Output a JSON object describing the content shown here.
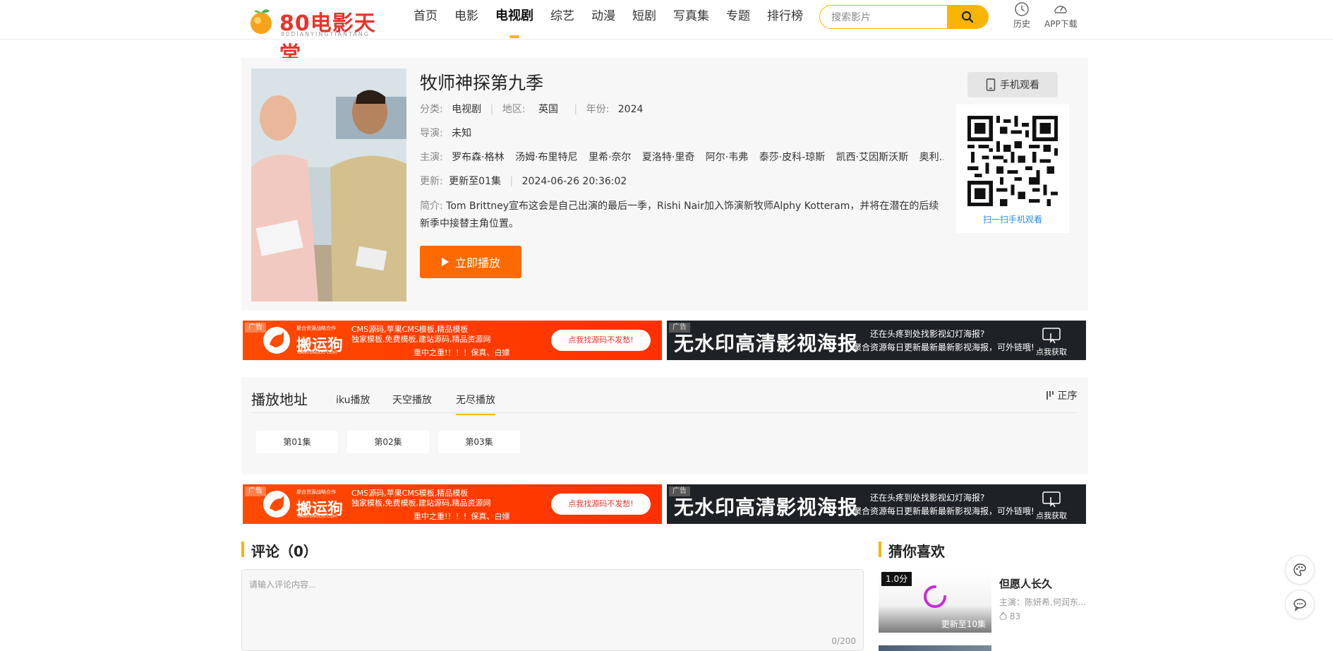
{
  "site": {
    "logo_text": "80电影天堂",
    "logo_sub": "80DIANYINGTIANTANG"
  },
  "nav": {
    "items": [
      {
        "label": "首页"
      },
      {
        "label": "电影"
      },
      {
        "label": "电视剧",
        "active": true
      },
      {
        "label": "综艺"
      },
      {
        "label": "动漫"
      },
      {
        "label": "短剧"
      },
      {
        "label": "写真集"
      },
      {
        "label": "专题"
      },
      {
        "label": "排行榜"
      }
    ],
    "search_placeholder": "搜索影片",
    "history_label": "历史",
    "app_label": "APP下载"
  },
  "detail": {
    "title": "牧师神探第九季",
    "category_key": "分类:",
    "category": "电视剧",
    "region_key": "地区:",
    "region": "英国",
    "year_key": "年份:",
    "year": "2024",
    "director_key": "导演:",
    "director": "未知",
    "cast_key": "主演:",
    "cast": [
      "罗布森·格林",
      "汤姆·布里特尼",
      "里希·奈尔",
      "夏洛特·里奇",
      "阿尔·韦弗",
      "泰莎·皮科-琼斯",
      "凯西·艾因斯沃斯",
      "奥利..."
    ],
    "update_key": "更新:",
    "update_status": "更新至01集",
    "update_time": "2024-06-26 20:36:02",
    "desc_key": "简介:",
    "desc": "Tom Brittney宣布这会是自己出演的最后一季，Rishi Nair加入饰演新牧师Alphy Kotteram，并将在潜在的后续新季中接替主角位置。",
    "play_label": "立即播放",
    "mobile_label": "手机观看",
    "qr_label": "扫一扫手机观看"
  },
  "ads": {
    "tag": "广告",
    "left_brand_top": "聚合资源战略合作",
    "left_brand": "搬运狗",
    "left_brand_url": "BANYUNGOU.COM",
    "left_line1": "CMS源码,苹果CMS模板,精品模板",
    "left_line2": "独家模板,免费模板,建站源码,精品资源网",
    "left_line3": "重中之重!！！！保真、白嫖",
    "left_cta": "点我找源码不发愁!",
    "right_title": "无水印高清影视海报",
    "right_line1": "还在头疼到处找影视幻灯海报?",
    "right_line2": "聚合资源每日更新最新最新影视海报，可外链哦!",
    "right_cta": "点我获取"
  },
  "playlist": {
    "title": "播放地址",
    "tabs": [
      {
        "label": "iku播放"
      },
      {
        "label": "天空播放"
      },
      {
        "label": "无尽播放",
        "active": true
      }
    ],
    "order_label": "正序",
    "episodes": [
      "第01集",
      "第02集",
      "第03集"
    ]
  },
  "comments": {
    "heading": "评论（0）",
    "placeholder": "请输入评论内容...",
    "count": "0/200"
  },
  "recommend": {
    "heading": "猜你喜欢",
    "items": [
      {
        "score": "1.0分",
        "update": "更新至10集",
        "title": "但愿人长久",
        "actors": "主演：陈妍希,何润东...",
        "hot": "83"
      }
    ]
  },
  "colors": {
    "accent": "#f7b500",
    "play": "#ff6a00",
    "link": "#2a8ee8"
  }
}
